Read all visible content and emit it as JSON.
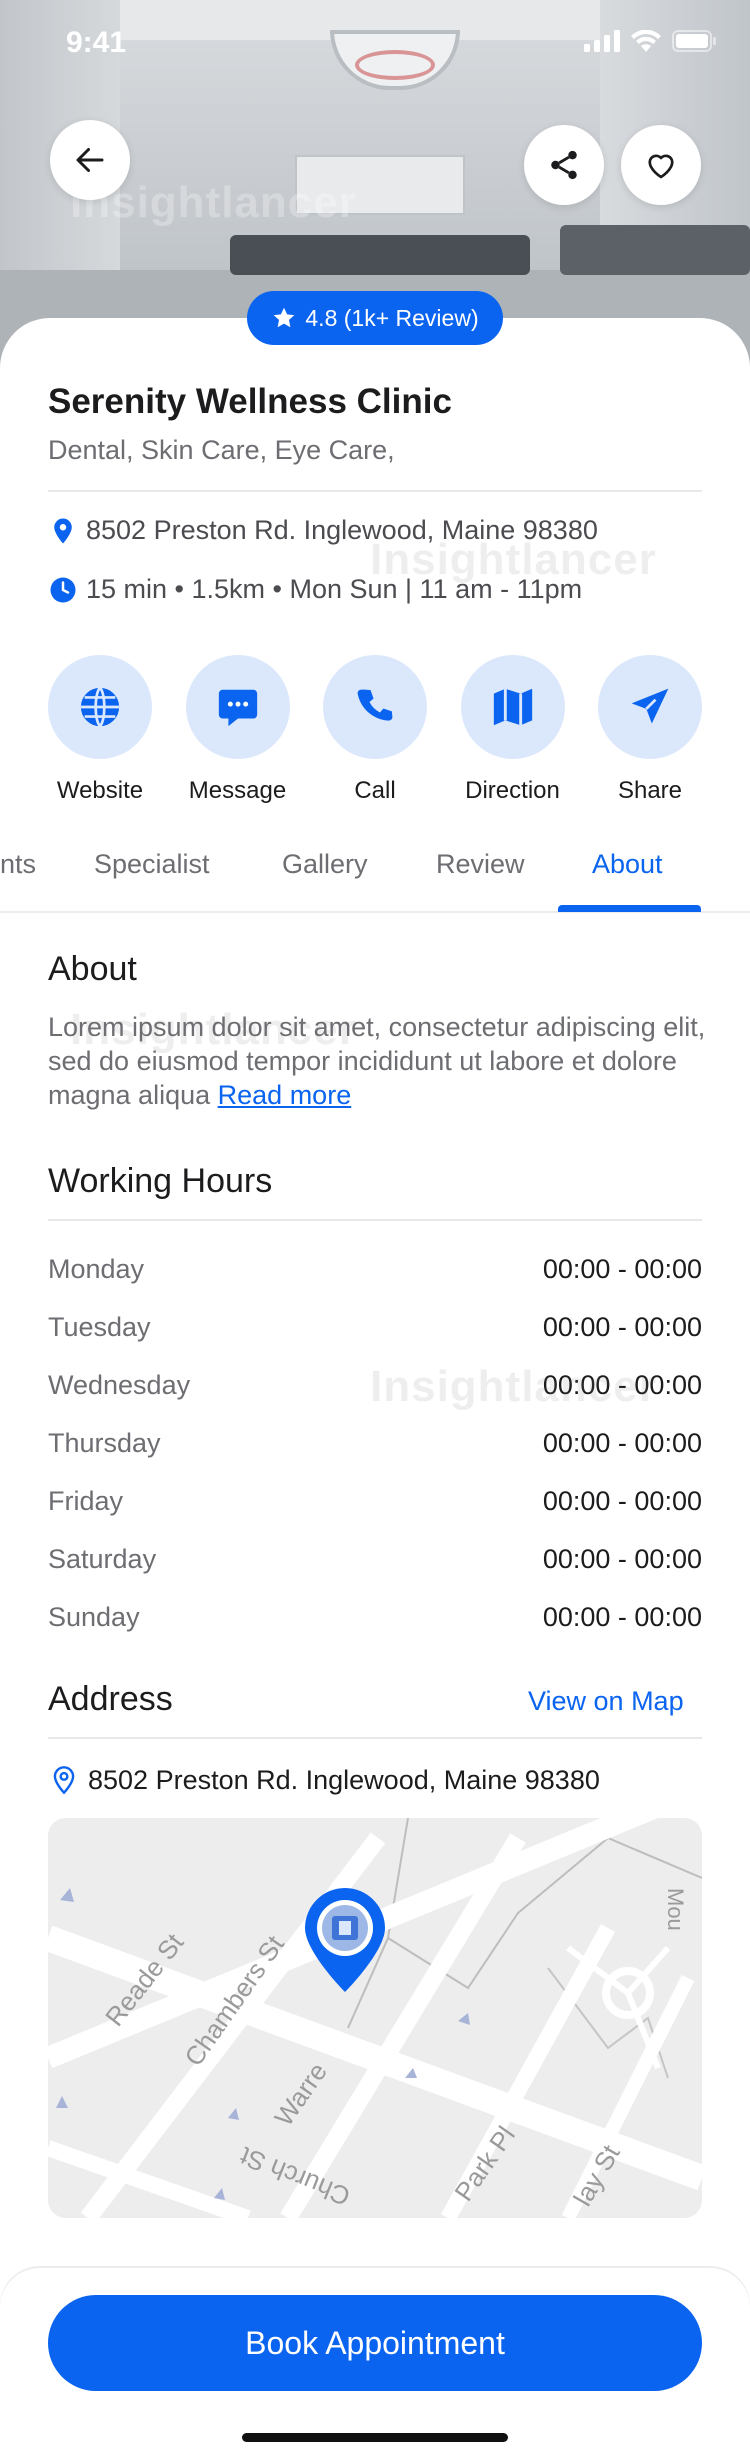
{
  "status_bar": {
    "time": "9:41"
  },
  "header": {
    "back_icon": "arrow-left-icon",
    "share_icon": "share-icon",
    "favorite_icon": "heart-icon"
  },
  "watermark": "Insightlancer",
  "rating": {
    "text": "4.8 (1k+ Review)",
    "icon": "star-icon"
  },
  "clinic": {
    "name": "Serenity Wellness Clinic",
    "categories": "Dental, Skin Care, Eye Care,",
    "address": "8502 Preston Rd. Inglewood, Maine 98380",
    "meta": "15 min • 1.5km • Mon Sun | 11 am - 11pm"
  },
  "actions": [
    {
      "label": "Website",
      "icon": "globe-icon"
    },
    {
      "label": "Message",
      "icon": "chat-icon"
    },
    {
      "label": "Call",
      "icon": "phone-icon"
    },
    {
      "label": "Direction",
      "icon": "map-icon"
    },
    {
      "label": "Share",
      "icon": "send-icon"
    }
  ],
  "tabs": [
    {
      "label": "nts",
      "active": false
    },
    {
      "label": "Specialist",
      "active": false
    },
    {
      "label": "Gallery",
      "active": false
    },
    {
      "label": "Review",
      "active": false
    },
    {
      "label": "About",
      "active": true
    }
  ],
  "about": {
    "heading": "About",
    "text": "Lorem ipsum dolor sit amet, consectetur adipiscing elit, sed do eiusmod tempor incididunt ut labore et dolore magna aliqua",
    "read_more": "Read more"
  },
  "working_hours": {
    "heading": "Working Hours",
    "rows": [
      {
        "day": "Monday",
        "time": "00:00 - 00:00"
      },
      {
        "day": "Tuesday",
        "time": "00:00 - 00:00"
      },
      {
        "day": "Wednesday",
        "time": "00:00 - 00:00"
      },
      {
        "day": "Thursday",
        "time": "00:00 - 00:00"
      },
      {
        "day": "Friday",
        "time": "00:00 - 00:00"
      },
      {
        "day": "Saturday",
        "time": "00:00 - 00:00"
      },
      {
        "day": "Sunday",
        "time": "00:00 - 00:00"
      }
    ]
  },
  "address_section": {
    "heading": "Address",
    "view_on_map": "View on Map",
    "address": "8502 Preston Rd. Inglewood, Maine 98380"
  },
  "map": {
    "streets": [
      "Reade St",
      "Chambers St",
      "Warre",
      "Church St",
      "Park Pl",
      "lay St",
      "Mou"
    ]
  },
  "book_button": "Book Appointment",
  "colors": {
    "primary": "#0a64f0",
    "primary_light": "#dbe8fc"
  }
}
